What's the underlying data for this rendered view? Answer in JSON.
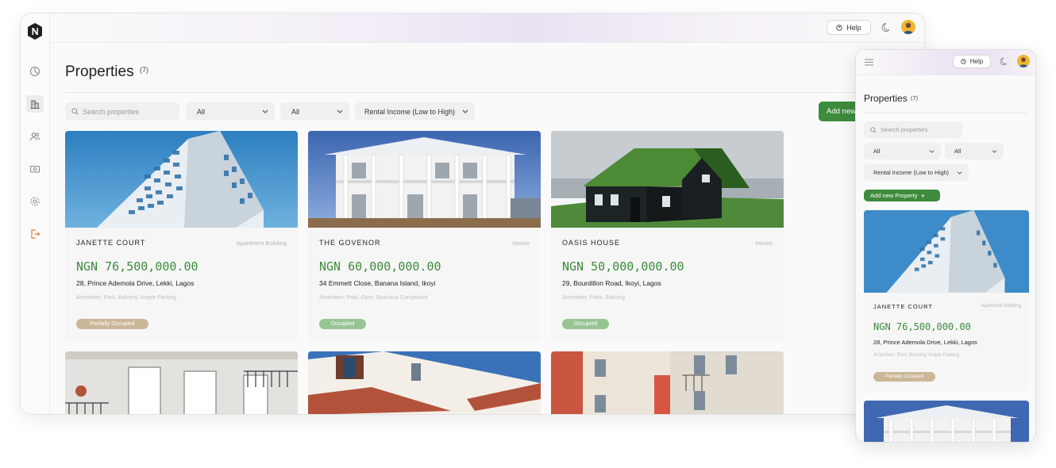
{
  "desktop": {
    "help_label": "Help",
    "page_title": "Properties",
    "count": "(7)",
    "search_placeholder": "Search properties",
    "filter1": "All",
    "filter2": "All",
    "sort": "Rental Income (Low to High)",
    "add_button": "Add new Property",
    "nav_icons": [
      "dashboard-icon",
      "properties-icon",
      "users-icon",
      "payments-icon",
      "settings-icon",
      "logout-icon"
    ],
    "cards": [
      {
        "name": "JANETTE COURT",
        "type": "Apartment Building",
        "price": "NGN 76,500,000.00",
        "address": "28, Prince Ademola Drive, Lekki, Lagos",
        "amenities": "Amenities: Pool, Balcony, Ample Parking",
        "status": "Partially Occupied"
      },
      {
        "name": "THE GOVENOR",
        "type": "House",
        "price": "NGN 60,000,000.00",
        "address": "34 Emmett Close, Banana Island, Ikoyi",
        "amenities": "Amenities: Pool, Gym, Spacious Compound",
        "status": "Occupied"
      },
      {
        "name": "OASIS HOUSE",
        "type": "House",
        "price": "NGN 50,000,000.00",
        "address": "29, Bourdillon Road, Ikoyi, Lagos",
        "amenities": "Amenities: Patio, Balcony",
        "status": "Occupied"
      }
    ]
  },
  "mobile": {
    "help_label": "Help",
    "page_title": "Properties",
    "count": "(7)",
    "search_placeholder": "Search properties",
    "filter1": "All",
    "filter2": "All",
    "sort": "Rental Income (Low to High)",
    "add_button": "Add new Property",
    "card": {
      "name": "JANETTE COURT",
      "type": "Apartment Building",
      "price": "NGN 76,500,000.00",
      "address": "28, Prince Ademola Drive, Lekki, Lagos",
      "amenities": "Amenities: Pool, Balcony, Ample Parking",
      "status": "Partially Occupied"
    }
  },
  "colors": {
    "accent_green": "#3d8b3d",
    "partial_badge": "#cbb797",
    "occupied_badge": "#97c493",
    "avatar": "#f2b632"
  }
}
